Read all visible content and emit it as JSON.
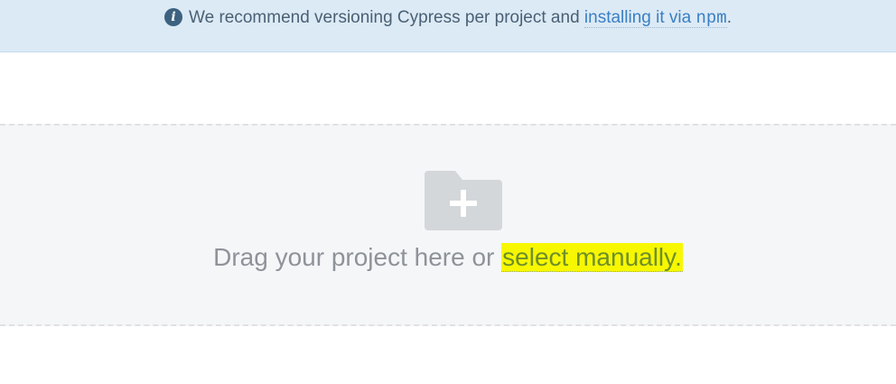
{
  "banner": {
    "icon": "info-icon",
    "icon_glyph": "i",
    "message_prefix": "We recommend versioning Cypress per project and ",
    "link_text": "installing it via ",
    "link_code": "npm",
    "message_suffix": "."
  },
  "dropzone": {
    "icon": "folder-add-icon",
    "prompt": "Drag your project here or ",
    "select_link": "select manually",
    "suffix": "."
  },
  "colors": {
    "banner_bg": "#dceaf5",
    "link": "#3a7fc4",
    "dropzone_bg": "#f5f6f8",
    "highlight": "#f7f700"
  }
}
